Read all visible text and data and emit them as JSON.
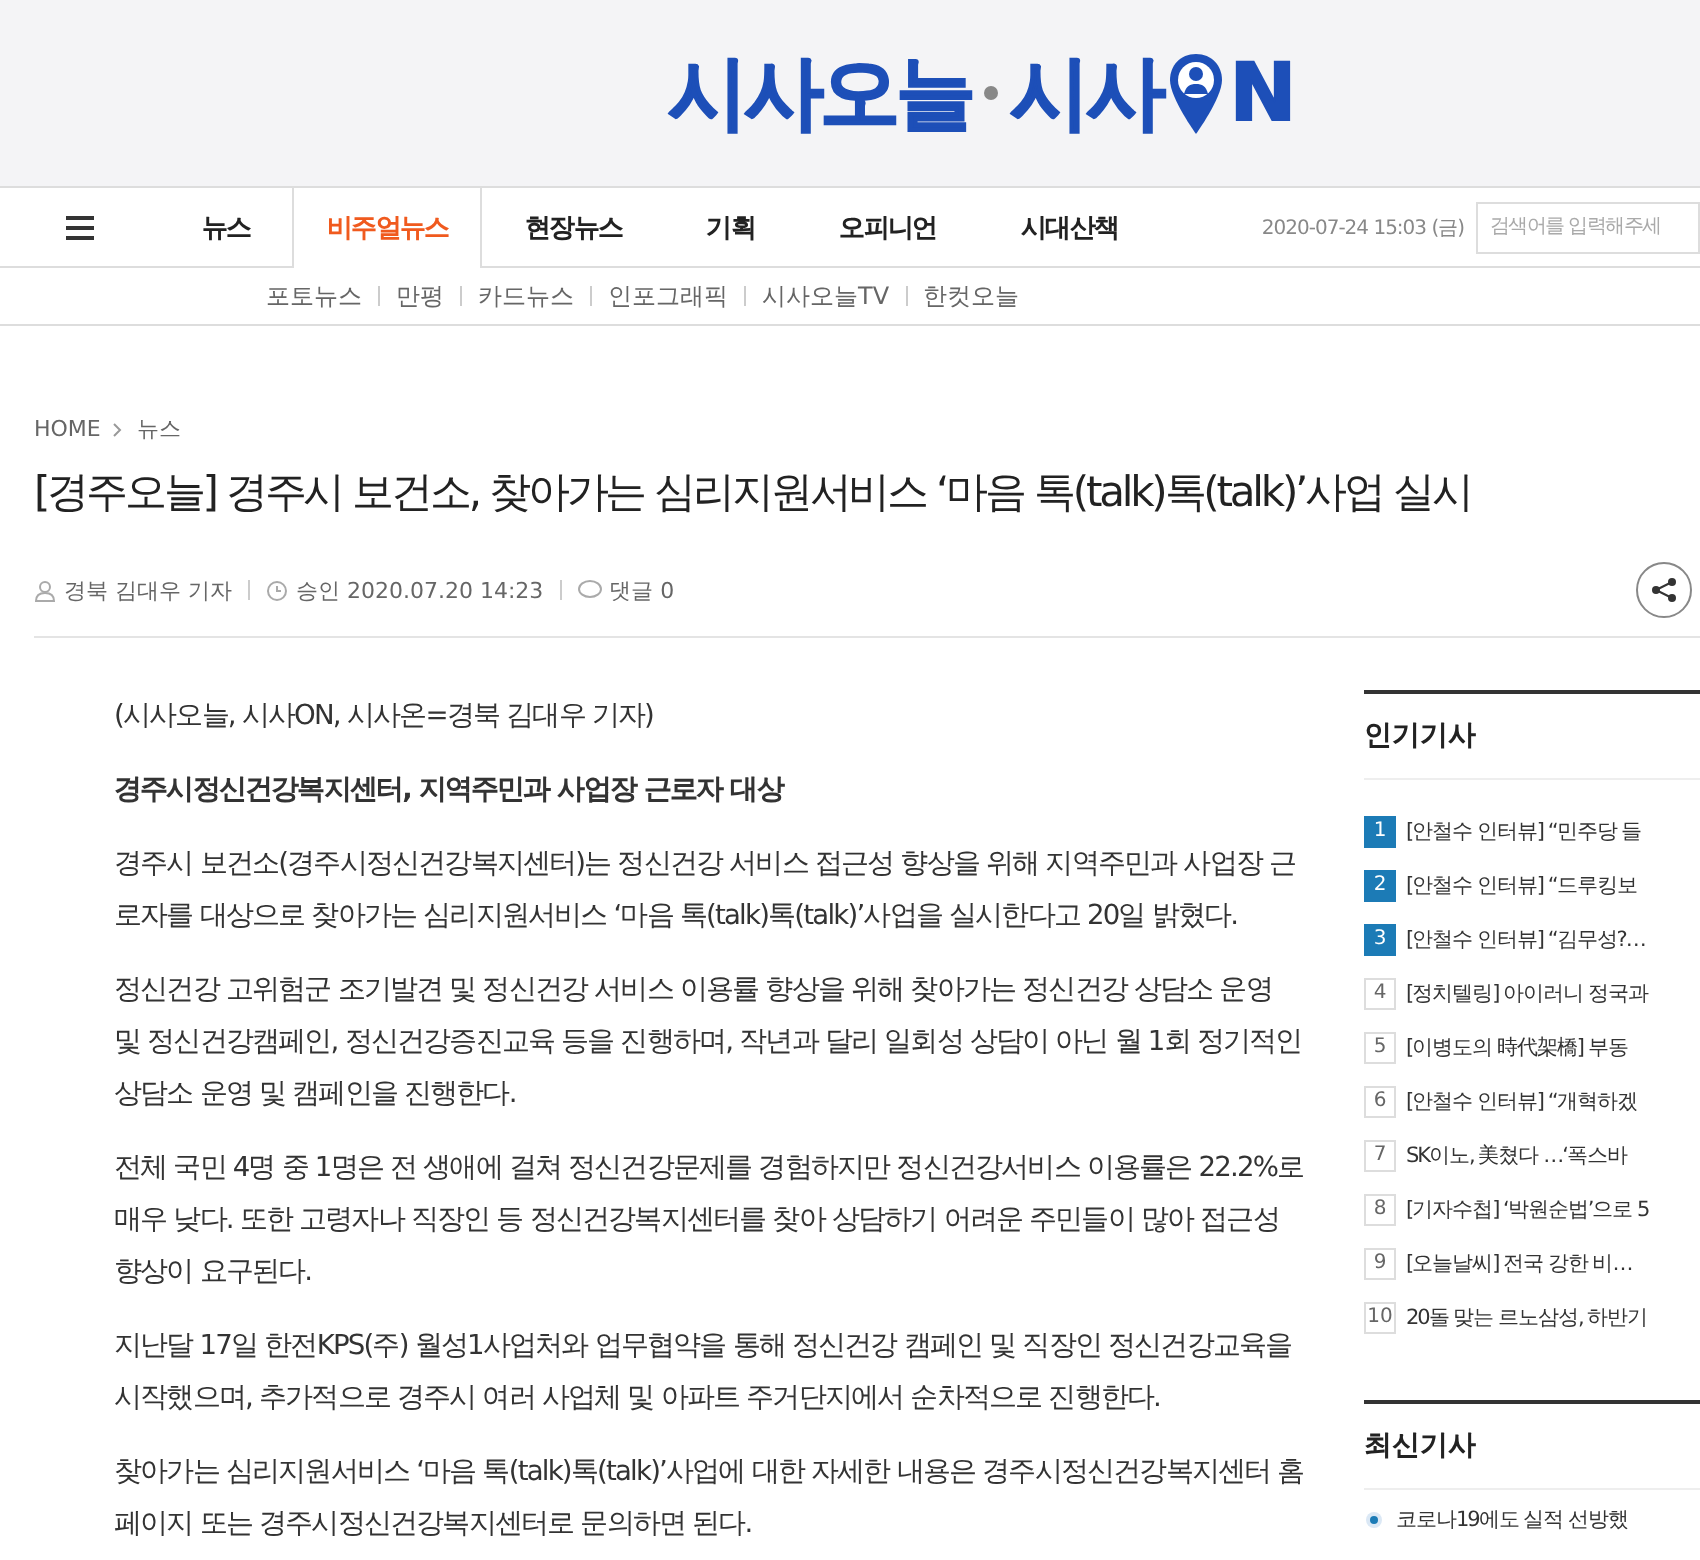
{
  "logo": {
    "parts": [
      "시사오늘",
      "시사",
      "N"
    ]
  },
  "nav": {
    "items": [
      {
        "label": "뉴스",
        "selected": false
      },
      {
        "label": "비주얼뉴스",
        "selected": true
      },
      {
        "label": "현장뉴스",
        "selected": false
      },
      {
        "label": "기획",
        "selected": false
      },
      {
        "label": "오피니언",
        "selected": false
      },
      {
        "label": "시대산책",
        "selected": false
      }
    ],
    "date": "2020-07-24 15:03 (금)",
    "search": {
      "placeholder": "검색어를 입력해주세"
    }
  },
  "subnav": [
    "포토뉴스",
    "만평",
    "카드뉴스",
    "인포그래픽",
    "시사오늘TV",
    "한컷오늘"
  ],
  "breadcrumb": [
    "HOME",
    "뉴스"
  ],
  "article": {
    "title": "[경주오늘] 경주시 보건소, 찾아가는 심리지원서비스 ‘마음 톡(talk)톡(talk)’사업 실시",
    "author": "경북 김대우 기자",
    "approved": "승인 2020.07.20 14:23",
    "comments": "댓글 0",
    "paragraphs": [
      {
        "kind": "plain",
        "text": "(시사오늘, 시사ON, 시사온=경북 김대우 기자)"
      },
      {
        "kind": "bold",
        "text": "경주시정신건강복지센터, 지역주민과 사업장 근로자 대상"
      },
      {
        "kind": "plain",
        "text": "경주시 보건소(경주시정신건강복지센터)는 정신건강 서비스 접근성 향상을 위해 지역주민과 사업장 근로자를 대상으로 찾아가는 심리지원서비스 ‘마음 톡(talk)톡(talk)’사업을 실시한다고 20일 밝혔다."
      },
      {
        "kind": "plain",
        "text": "정신건강 고위험군 조기발견 및 정신건강 서비스 이용률 향상을 위해 찾아가는 정신건강 상담소 운영 및 정신건강캠페인, 정신건강증진교육 등을 진행하며, 작년과 달리 일회성 상담이 아닌 월 1회 정기적인 상담소 운영 및 캠페인을 진행한다."
      },
      {
        "kind": "plain",
        "text": "전체 국민 4명 중 1명은 전 생애에 걸쳐 정신건강문제를 경험하지만 정신건강서비스 이용률은 22.2%로 매우 낮다. 또한 고령자나 직장인 등 정신건강복지센터를 찾아 상담하기 어려운 주민들이 많아 접근성 향상이 요구된다."
      },
      {
        "kind": "plain",
        "text": "지난달 17일 한전KPS(주) 월성1사업처와 업무협약을 통해 정신건강 캠페인 및 직장인 정신건강교육을 시작했으며, 추가적으로 경주시 여러 사업체 및 아파트 주거단지에서 순차적으로 진행한다."
      },
      {
        "kind": "plain",
        "text": "찾아가는 심리지원서비스 ‘마음 톡(talk)톡(talk)’사업에 대한 자세한 내용은 경주시정신건강복지센터 홈페이지 또는 경주시정신건강복지센터로 문의하면 된다."
      }
    ]
  },
  "popular": {
    "title": "인기기사",
    "items": [
      {
        "rank": "1",
        "title": "[안철수 인터뷰] “민주당 들",
        "top": true
      },
      {
        "rank": "2",
        "title": "[안철수 인터뷰] “드루킹보",
        "top": true
      },
      {
        "rank": "3",
        "title": "[안철수 인터뷰] “김무성?…",
        "top": true
      },
      {
        "rank": "4",
        "title": "[정치텔링] 아이러니 정국과",
        "top": false
      },
      {
        "rank": "5",
        "title": "[이병도의 時代架橋] 부동",
        "top": false
      },
      {
        "rank": "6",
        "title": "[안철수 인터뷰] “개혁하겠",
        "top": false
      },
      {
        "rank": "7",
        "title": "SK이노, 美쳤다 …‘폭스바",
        "top": false
      },
      {
        "rank": "8",
        "title": "[기자수첩] ‘박원순법’으로 5",
        "top": false
      },
      {
        "rank": "9",
        "title": "[오늘날씨] 전국 강한 비…",
        "top": false
      },
      {
        "rank": "10",
        "title": "20돌 맞는 르노삼성, 하반기",
        "top": false
      }
    ]
  },
  "latest": {
    "title": "최신기사",
    "items": [
      "코로나19에도 실적 선방했"
    ]
  }
}
